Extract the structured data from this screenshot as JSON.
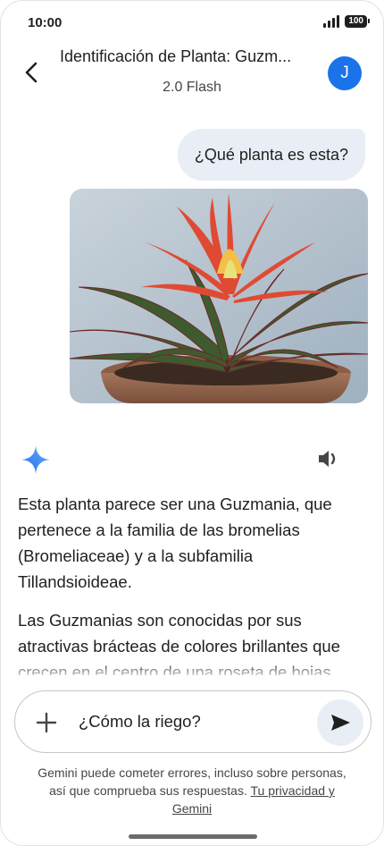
{
  "status": {
    "time": "10:00",
    "battery": "100"
  },
  "header": {
    "title": "Identificación de Planta: Guzm...",
    "subtitle": "2.0 Flash",
    "avatar_initial": "J"
  },
  "user_message": "¿Qué planta es esta?",
  "image": {
    "description_icon": "plant-photo"
  },
  "response": {
    "paragraphs": [
      "Esta planta parece ser una Guzmania, que pertenece a la familia de las bromelias (Bromeliaceae) y a la subfamilia Tillandsioideae.",
      "Las Guzmanias son conocidas por sus atractivas brácteas de colores brillantes que crecen en el centro de una roseta de hojas"
    ]
  },
  "input": {
    "value": "¿Cómo la riego?"
  },
  "disclaimer": {
    "text": "Gemini puede cometer errores, incluso sobre personas, así que comprueba sus respuestas.",
    "link": "Tu privacidad y Gemini"
  },
  "colors": {
    "accent": "#1a73e8",
    "bubble": "#e9eef6"
  }
}
